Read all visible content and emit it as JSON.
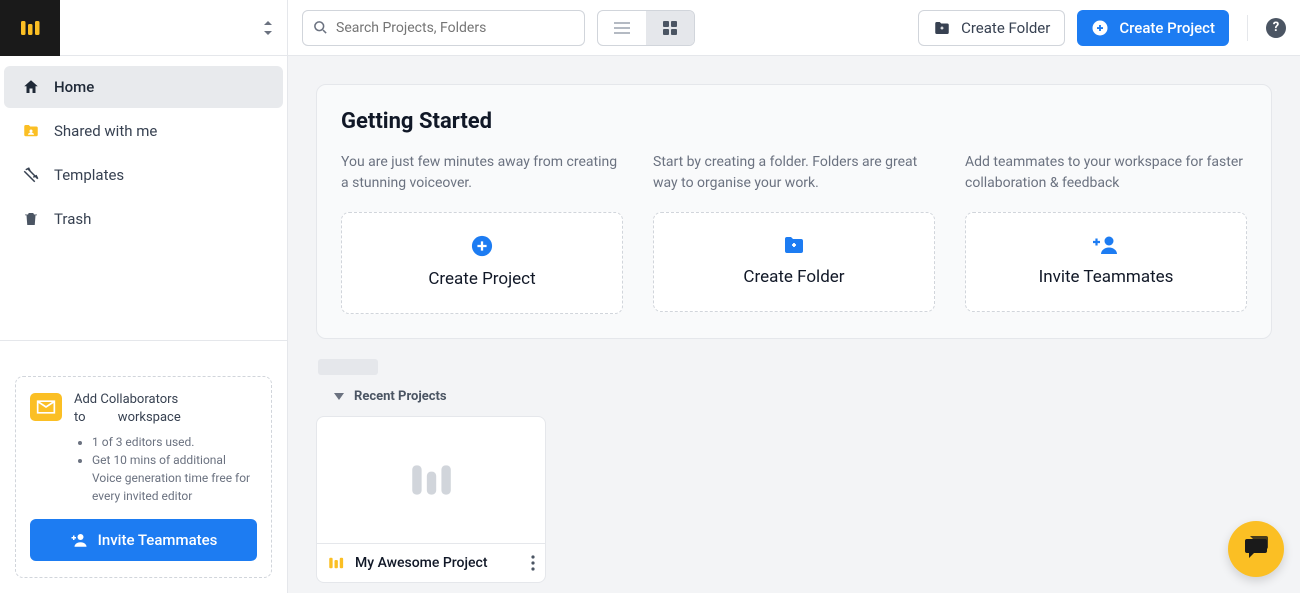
{
  "sidebar": {
    "nav": [
      {
        "label": "Home"
      },
      {
        "label": "Shared with me"
      },
      {
        "label": "Templates"
      },
      {
        "label": "Trash"
      }
    ],
    "collab": {
      "line1": "Add Collaborators",
      "line2_prefix": "to",
      "line2_suffix": "workspace",
      "bullets": [
        "1 of 3 editors used.",
        "Get 10 mins of additional Voice generation time free for every invited editor"
      ],
      "invite_label": "Invite Teammates"
    }
  },
  "topbar": {
    "search_placeholder": "Search Projects, Folders",
    "create_folder_label": "Create Folder",
    "create_project_label": "Create Project"
  },
  "getting_started": {
    "title": "Getting Started",
    "cols": [
      {
        "desc": "You are just few minutes away from creating a stunning voiceover.",
        "card_label": "Create Project"
      },
      {
        "desc": "Start by creating a folder. Folders are great way to organise your work.",
        "card_label": "Create Folder"
      },
      {
        "desc": "Add teammates to your workspace for faster collaboration & feedback",
        "card_label": "Invite Teammates"
      }
    ]
  },
  "recent": {
    "header": "Recent Projects",
    "projects": [
      {
        "title": "My Awesome Project"
      }
    ]
  }
}
